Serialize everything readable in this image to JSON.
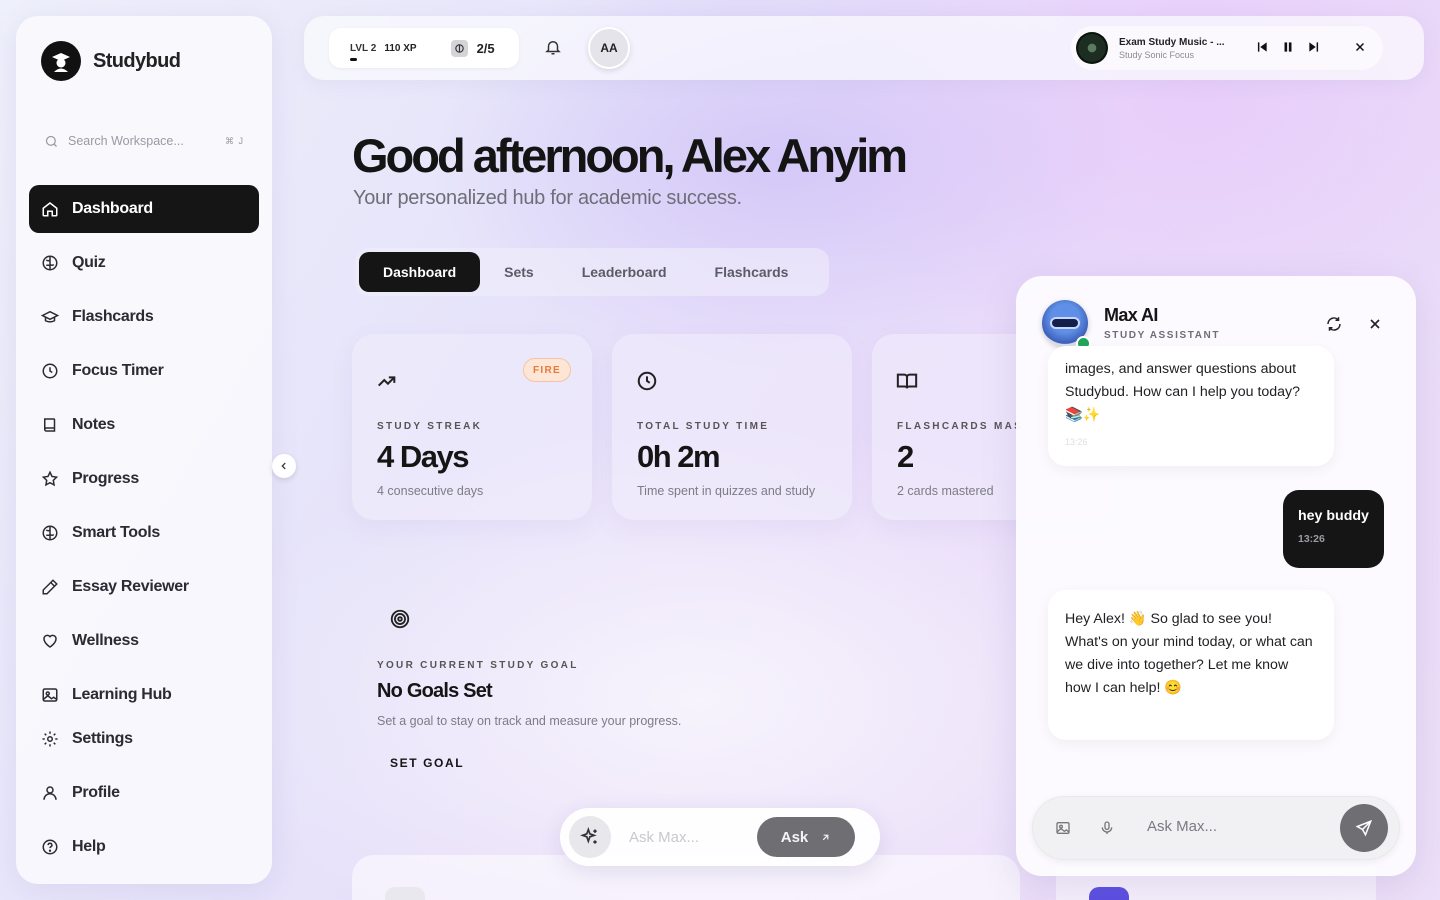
{
  "sidebar": {
    "brand": "Studybud",
    "search_placeholder": "Search Workspace...",
    "search_shortcut": "⌘ J",
    "items": [
      {
        "label": "Dashboard",
        "icon": "home-icon",
        "active": true
      },
      {
        "label": "Quiz",
        "icon": "brain-icon"
      },
      {
        "label": "Flashcards",
        "icon": "graduation-cap-icon"
      },
      {
        "label": "Focus Timer",
        "icon": "clock-icon"
      },
      {
        "label": "Notes",
        "icon": "book-icon"
      },
      {
        "label": "Progress",
        "icon": "star-icon"
      },
      {
        "label": "Smart Tools",
        "icon": "brain-icon"
      },
      {
        "label": "Essay Reviewer",
        "icon": "pencil-icon"
      },
      {
        "label": "Wellness",
        "icon": "heart-icon"
      },
      {
        "label": "Learning Hub",
        "icon": "image-icon"
      },
      {
        "label": "Settings",
        "icon": "gear-icon"
      },
      {
        "label": "Profile",
        "icon": "user-icon"
      },
      {
        "label": "Help",
        "icon": "help-circle-icon"
      }
    ]
  },
  "topbar": {
    "level": "LVL 2",
    "xp": "110 XP",
    "streak_progress": "2/5",
    "avatar_initials": "AA",
    "player": {
      "title": "Exam Study Music - ...",
      "artist": "Study Sonic Focus"
    }
  },
  "main": {
    "greeting": "Good afternoon, Alex Anyim",
    "subtitle": "Your personalized hub for academic success.",
    "tabs": [
      {
        "label": "Dashboard",
        "active": true
      },
      {
        "label": "Sets"
      },
      {
        "label": "Leaderboard"
      },
      {
        "label": "Flashcards"
      }
    ],
    "stats": [
      {
        "label": "STUDY STREAK",
        "value": "4 Days",
        "sub": "4 consecutive days",
        "badge": "FIRE",
        "icon": "trending-up-icon"
      },
      {
        "label": "TOTAL STUDY TIME",
        "value": "0h 2m",
        "sub": "Time spent in quizzes and study",
        "icon": "clock-icon"
      },
      {
        "label": "FLASHCARDS MAS",
        "value": "2",
        "sub": "2 cards mastered",
        "icon": "book-open-icon"
      }
    ],
    "goal": {
      "label": "YOUR CURRENT STUDY GOAL",
      "title": "No Goals Set",
      "sub": "Set a goal to stay on track and measure your progress.",
      "button": "SET GOAL"
    },
    "ask": {
      "placeholder": "Ask Max...",
      "button": "Ask"
    }
  },
  "chat": {
    "name": "Max AI",
    "role": "STUDY ASSISTANT",
    "messages": [
      {
        "from": "bot",
        "text": "images, and answer questions about Studybud. How can I help you today? 📚✨",
        "time": "13:26"
      },
      {
        "from": "user",
        "text": "hey buddy",
        "time": "13:26"
      },
      {
        "from": "bot",
        "text": "Hey Alex! 👋 So glad to see you! What's on your mind today, or what can we dive into together? Let me know how I can help! 😊"
      }
    ],
    "input_placeholder": "Ask Max..."
  },
  "colors": {
    "accent": "#151515",
    "fire_badge": "#e8793a",
    "online": "#22a55b"
  }
}
